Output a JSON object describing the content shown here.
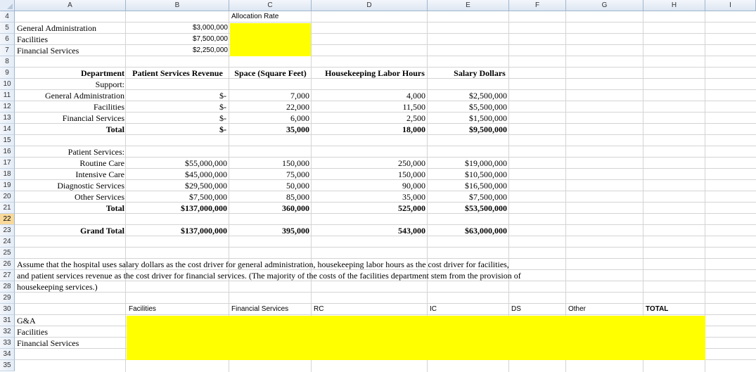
{
  "colors": {
    "highlight": "#ffff00",
    "header_bg": "#e4ecf7",
    "selected_row": "#f9d99a"
  },
  "columns": [
    "A",
    "B",
    "C",
    "D",
    "E",
    "F",
    "G",
    "H",
    "I"
  ],
  "rows": [
    "4",
    "5",
    "6",
    "7",
    "8",
    "9",
    "10",
    "11",
    "12",
    "13",
    "14",
    "15",
    "16",
    "17",
    "18",
    "19",
    "20",
    "21",
    "22",
    "23",
    "24",
    "25",
    "26",
    "27",
    "28",
    "29",
    "30",
    "31",
    "32",
    "33",
    "34",
    "35"
  ],
  "selected_row": "22",
  "allocation": {
    "header": "Allocation Rate",
    "items": [
      {
        "label": "General Administration",
        "amount": "$3,000,000"
      },
      {
        "label": "Facilities",
        "amount": "$7,500,000"
      },
      {
        "label": "Financial Services",
        "amount": "$2,250,000"
      }
    ]
  },
  "table": {
    "headers": {
      "department": "Department",
      "revenue": "Patient Services Revenue",
      "space": "Space (Square Feet)",
      "hours": "Housekeeping Labor Hours",
      "salary": "Salary Dollars"
    },
    "support_label": "Support:",
    "support": [
      {
        "name": "General Administration",
        "revenue": "$-",
        "space": "7,000",
        "hours": "4,000",
        "salary": "$2,500,000"
      },
      {
        "name": "Facilities",
        "revenue": "$-",
        "space": "22,000",
        "hours": "11,500",
        "salary": "$5,500,000"
      },
      {
        "name": "Financial Services",
        "revenue": "$-",
        "space": "6,000",
        "hours": "2,500",
        "salary": "$1,500,000"
      }
    ],
    "support_total": {
      "name": "Total",
      "revenue": "$-",
      "space": "35,000",
      "hours": "18,000",
      "salary": "$9,500,000"
    },
    "patient_label": "Patient Services:",
    "patient": [
      {
        "name": "Routine Care",
        "revenue": "$55,000,000",
        "space": "150,000",
        "hours": "250,000",
        "salary": "$19,000,000"
      },
      {
        "name": "Intensive Care",
        "revenue": "$45,000,000",
        "space": "75,000",
        "hours": "150,000",
        "salary": "$10,500,000"
      },
      {
        "name": "Diagnostic Services",
        "revenue": "$29,500,000",
        "space": "50,000",
        "hours": "90,000",
        "salary": "$16,500,000"
      },
      {
        "name": "Other Services",
        "revenue": "$7,500,000",
        "space": "85,000",
        "hours": "35,000",
        "salary": "$7,500,000"
      }
    ],
    "patient_total": {
      "name": "Total",
      "revenue": "$137,000,000",
      "space": "360,000",
      "hours": "525,000",
      "salary": "$53,500,000"
    },
    "grand_total": {
      "name": "Grand Total",
      "revenue": "$137,000,000",
      "space": "395,000",
      "hours": "543,000",
      "salary": "$63,000,000"
    }
  },
  "note": [
    "Assume that the hospital uses salary dollars as the cost driver for general administration, housekeeping labor hours as the cost driver for facilities,",
    "and patient services revenue as the cost driver for financial services.  (The majority of the costs of the facilities department stem from the provision of",
    "housekeeping services.)"
  ],
  "alloc_table": {
    "headers": [
      "Facilities",
      "Financial Services",
      "RC",
      "IC",
      "DS",
      "Other",
      "TOTAL"
    ],
    "rows": [
      "G&A",
      "Facilities",
      "Financial Services"
    ]
  }
}
